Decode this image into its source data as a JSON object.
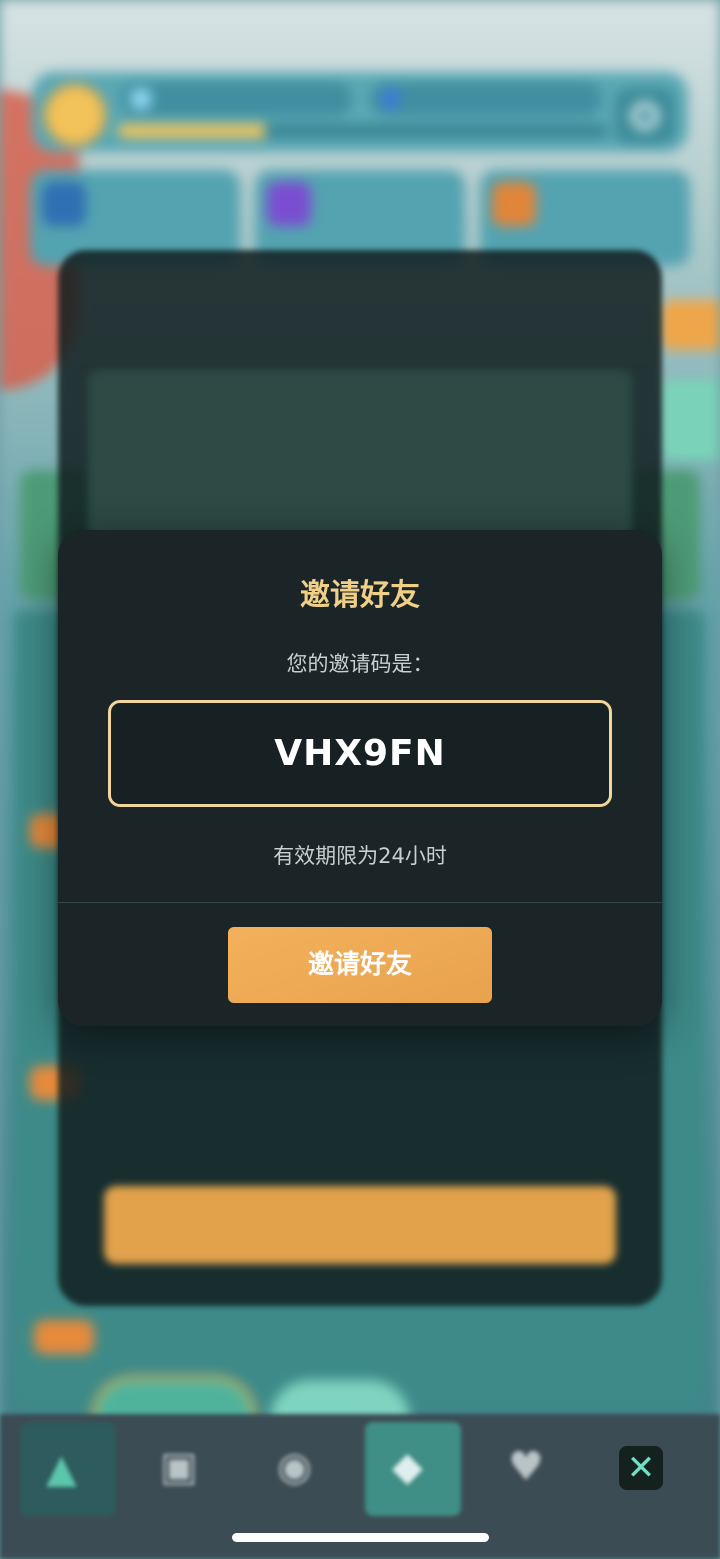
{
  "invite_modal": {
    "title": "邀请好友",
    "code_label": "您的邀请码是：",
    "invite_code": "VHX9FN",
    "validity_text": "有效期限为24小时",
    "invite_button": "邀请好友"
  },
  "colors": {
    "accent_gold": "#f0cf86",
    "button_orange": "#eda955",
    "modal_bg": "#1b2427",
    "close_icon": "#6fe1c8"
  },
  "background": {
    "resource_progress_fraction": 0.3
  },
  "bottom_nav": {
    "items": [
      {
        "icon": "triangle-icon"
      },
      {
        "icon": "bag-icon"
      },
      {
        "icon": "compass-icon"
      },
      {
        "icon": "diamond-icon"
      },
      {
        "icon": "heart-icon"
      },
      {
        "icon": "close-icon"
      }
    ]
  }
}
